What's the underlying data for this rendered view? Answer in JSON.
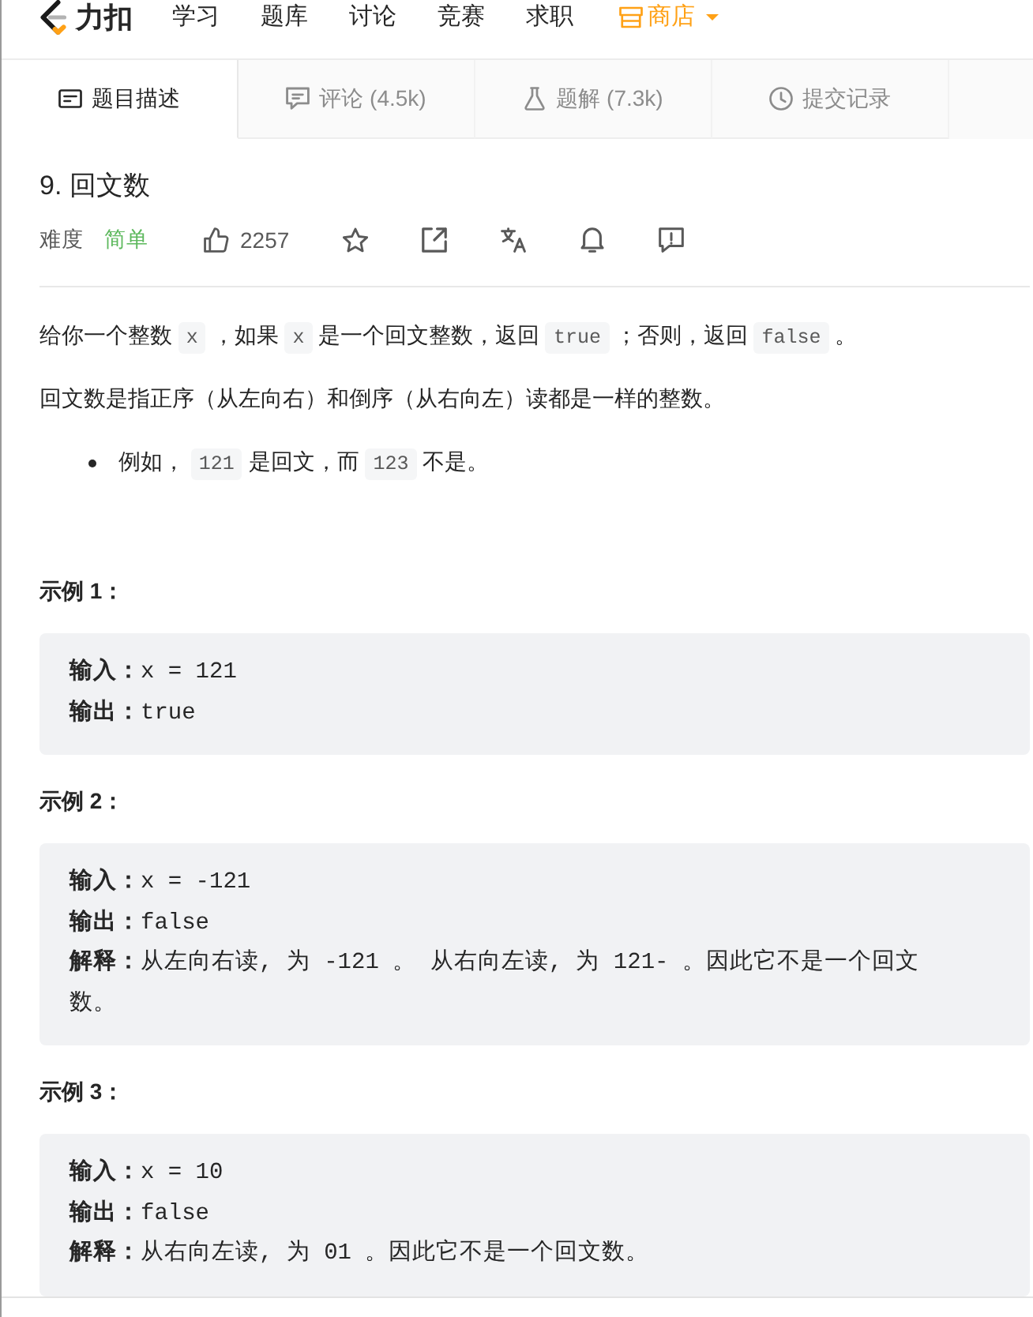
{
  "nav": {
    "logo": "力扣",
    "items": [
      {
        "label": "学习",
        "kind": "link"
      },
      {
        "label": "题库",
        "kind": "link"
      },
      {
        "label": "讨论",
        "kind": "link"
      },
      {
        "label": "竞赛",
        "kind": "link"
      },
      {
        "label": "求职",
        "kind": "link"
      },
      {
        "label": "商店",
        "kind": "store"
      }
    ]
  },
  "tabs": [
    {
      "label": "题目描述",
      "selected": true
    },
    {
      "label": "评论 (4.5k)",
      "selected": false
    },
    {
      "label": "题解 (7.3k)",
      "selected": false
    },
    {
      "label": "提交记录",
      "selected": false
    }
  ],
  "problem": {
    "title": "9. 回文数",
    "difficulty_label": "难度",
    "difficulty": "简单",
    "likes": "2257"
  },
  "description": [
    {
      "kind": "paragraph",
      "segments": [
        {
          "kind": "text",
          "text": "给你一个整数 "
        },
        {
          "kind": "code",
          "text": "x"
        },
        {
          "kind": "text",
          "text": " ，如果 "
        },
        {
          "kind": "code",
          "text": "x"
        },
        {
          "kind": "text",
          "text": " 是一个回文整数，返回 "
        },
        {
          "kind": "code",
          "text": "true"
        },
        {
          "kind": "text",
          "text": " ；否则，返回 "
        },
        {
          "kind": "code",
          "text": "false"
        },
        {
          "kind": "text",
          "text": " 。"
        }
      ]
    },
    {
      "kind": "paragraph",
      "segments": [
        {
          "kind": "text",
          "text": "回文数是指正序（从左向右）和倒序（从右向左）读都是一样的整数。"
        }
      ]
    },
    {
      "kind": "bullets",
      "items": [
        [
          {
            "kind": "text",
            "text": "例如， "
          },
          {
            "kind": "code",
            "text": "121"
          },
          {
            "kind": "text",
            "text": " 是回文，而 "
          },
          {
            "kind": "code",
            "text": "123"
          },
          {
            "kind": "text",
            "text": " 不是。"
          }
        ]
      ]
    }
  ],
  "examples": [
    {
      "heading": "示例 1：",
      "lines": [
        "**输入：**x = 121",
        "**输出：**true"
      ]
    },
    {
      "heading": "示例 2：",
      "lines": [
        "**输入：**x = -121",
        "**输出：**false",
        "**解释：**从左向右读, 为 -121 。 从右向左读, 为 121- 。因此它不是一个回文数。"
      ]
    },
    {
      "heading": "示例 3：",
      "lines": [
        "**输入：**x = 10",
        "**输出：**false",
        "**解释：**从右向左读, 为 01 。因此它不是一个回文数。"
      ]
    }
  ]
}
